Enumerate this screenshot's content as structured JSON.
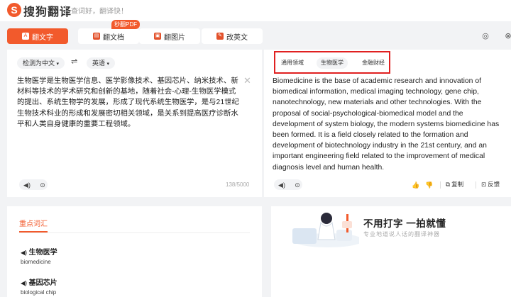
{
  "header": {
    "logo_mark": "S",
    "logo_text": "搜狗翻译",
    "slogan": "查词好，翻译快！"
  },
  "tabs": [
    {
      "label": "翻文字",
      "icon": "text-icon",
      "icon_glyph": "A"
    },
    {
      "label": "翻文档",
      "icon": "document-icon",
      "icon_glyph": "▤"
    },
    {
      "label": "翻图片",
      "icon": "image-icon",
      "icon_glyph": "▣"
    },
    {
      "label": "改英文",
      "icon": "edit-english-icon",
      "icon_glyph": "✎"
    }
  ],
  "pdf_badge": "秒翻PDF",
  "source": {
    "lang": "检测为中文",
    "text": "生物医学是生物医学信息、医学影像技术、基因芯片、纳米技术、新材料等技术的学术研究和创新的基地，随着社会-心理-生物医学模式的提出、系统生物学的发展，形成了现代系统生物医学，是与21世纪生物技术科业的形成和发展密切相关领域，是关系到提高医疗诊断水平和人类自身健康的重要工程领域。",
    "char_count": "138/5000"
  },
  "target": {
    "lang": "英语",
    "domains": [
      "通用领域",
      "生物医学",
      "金融财经"
    ],
    "selected_domain": "生物医学",
    "text": "Biomedicine is the base of academic research and innovation of biomedical information, medical imaging technology, gene chip, nanotechnology, new materials and other technologies. With the proposal of social-psychological-biomedical model and the development of system biology, the modern systems biomedicine has been formed. It is a field closely related to the formation and development of biotechnology industry in the 21st century, and an important engineering field related to the improvement of medical diagnosis level and human health.",
    "copy_label": "复制",
    "feedback_label": "反馈"
  },
  "keywords": {
    "title": "重点词汇",
    "items": [
      {
        "word": "生物医学",
        "translation": "biomedicine"
      },
      {
        "word": "基因芯片",
        "translation": "biological chip"
      }
    ]
  },
  "promo": {
    "title": "不用打字  一拍就懂",
    "subtitle": "专业地道说人话的翻译神器"
  },
  "colors": {
    "accent": "#f25a2c",
    "highlight_box": "#e02020"
  }
}
